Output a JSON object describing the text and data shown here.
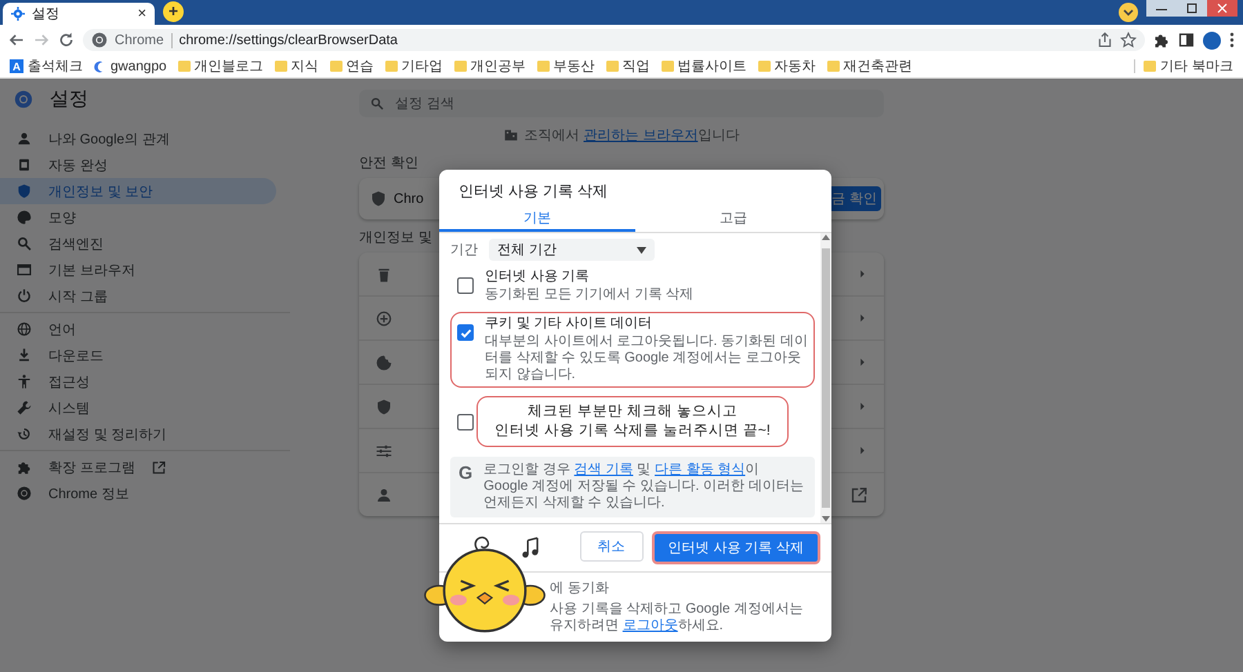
{
  "browser": {
    "tab": {
      "title": "설정",
      "close": "×"
    },
    "new_tab": "+",
    "address": {
      "site": "Chrome",
      "url": "chrome://settings/clearBrowserData"
    },
    "bookmarks": [
      {
        "label": "출석체크",
        "kind": "app",
        "badge": "A"
      },
      {
        "label": "gwangpo",
        "kind": "site"
      },
      {
        "label": "개인블로그",
        "kind": "folder"
      },
      {
        "label": "지식",
        "kind": "folder"
      },
      {
        "label": "연습",
        "kind": "folder"
      },
      {
        "label": "기타업",
        "kind": "folder"
      },
      {
        "label": "개인공부",
        "kind": "folder"
      },
      {
        "label": "부동산",
        "kind": "folder"
      },
      {
        "label": "직업",
        "kind": "folder"
      },
      {
        "label": "법률사이트",
        "kind": "folder"
      },
      {
        "label": "자동차",
        "kind": "folder"
      },
      {
        "label": "재건축관련",
        "kind": "folder"
      }
    ],
    "other_bookmarks": "기타 북마크"
  },
  "sidebar": {
    "title": "설정",
    "groups": [
      [
        {
          "label": "나와 Google의 관계",
          "selected": false,
          "external": false
        },
        {
          "label": "자동 완성",
          "selected": false,
          "external": false
        },
        {
          "label": "개인정보 및 보안",
          "selected": true,
          "external": false
        },
        {
          "label": "모양",
          "selected": false,
          "external": false
        },
        {
          "label": "검색엔진",
          "selected": false,
          "external": false
        },
        {
          "label": "기본 브라우저",
          "selected": false,
          "external": false
        },
        {
          "label": "시작 그룹",
          "selected": false,
          "external": false
        }
      ],
      [
        {
          "label": "언어",
          "selected": false,
          "external": false
        },
        {
          "label": "다운로드",
          "selected": false,
          "external": false
        },
        {
          "label": "접근성",
          "selected": false,
          "external": false
        },
        {
          "label": "시스템",
          "selected": false,
          "external": false
        },
        {
          "label": "재설정 및 정리하기",
          "selected": false,
          "external": false
        }
      ],
      [
        {
          "label": "확장 프로그램",
          "selected": false,
          "external": true
        },
        {
          "label": "Chrome 정보",
          "selected": false,
          "external": false
        }
      ]
    ]
  },
  "main": {
    "search_placeholder": "설정 검색",
    "managed": {
      "text": "조직에서 ",
      "link": "관리하는 브라우저",
      "suffix": "입니다"
    },
    "safety_heading": "안전 확인",
    "safety_text": "Chro",
    "safety_button": "금 확인",
    "privacy_heading": "개인정보 및",
    "privacy_rows": [
      {
        "external": false
      },
      {
        "external": false
      },
      {
        "external": false
      },
      {
        "external": false
      },
      {
        "external": false
      },
      {
        "external": true
      }
    ]
  },
  "dialog": {
    "title": "인터넷 사용 기록 삭제",
    "tabs": [
      {
        "label": "기본",
        "selected": true
      },
      {
        "label": "고급",
        "selected": false
      }
    ],
    "period_label": "기간",
    "period_value": "전체 기간",
    "items": [
      {
        "title": "인터넷 사용 기록",
        "desc": "동기화된 모든 기기에서 기록 삭제",
        "checked": false,
        "highlighted": false
      },
      {
        "title": "쿠키 및 기타 사이트 데이터",
        "desc": "대부분의 사이트에서 로그아웃됩니다. 동기화된 데이터를 삭제할 수 있도록 Google 계정에서는 로그아웃되지 않습니다.",
        "checked": true,
        "highlighted": true
      },
      {
        "checked": false,
        "highlighted": false
      }
    ],
    "info_logo": "G",
    "info": [
      {
        "kind": "text",
        "text": "로그인할 경우 "
      },
      {
        "kind": "link",
        "text": "검색 기록"
      },
      {
        "kind": "text",
        "text": " 및 "
      },
      {
        "kind": "link",
        "text": "다른 활동 형식"
      },
      {
        "kind": "text",
        "text": "이 Google 계정에 저장될 수 있습니다. 이러한 데이터는 언제든지 삭제할 수 있습니다."
      }
    ],
    "cancel": "취소",
    "confirm": "인터넷 사용 기록 삭제",
    "confirm_highlighted": true,
    "sync_text": "에 동기화",
    "note": {
      "text": "사용 기록을 삭제하고 Google 계정에서는 유지하려면 ",
      "link": "로그아웃",
      "suffix": "하세요."
    }
  },
  "annotation": {
    "lines": [
      "체크된 부분만 체크해 놓으시고",
      "인터넷 사용 기록 삭제를 눌러주시면 끝~!"
    ]
  }
}
